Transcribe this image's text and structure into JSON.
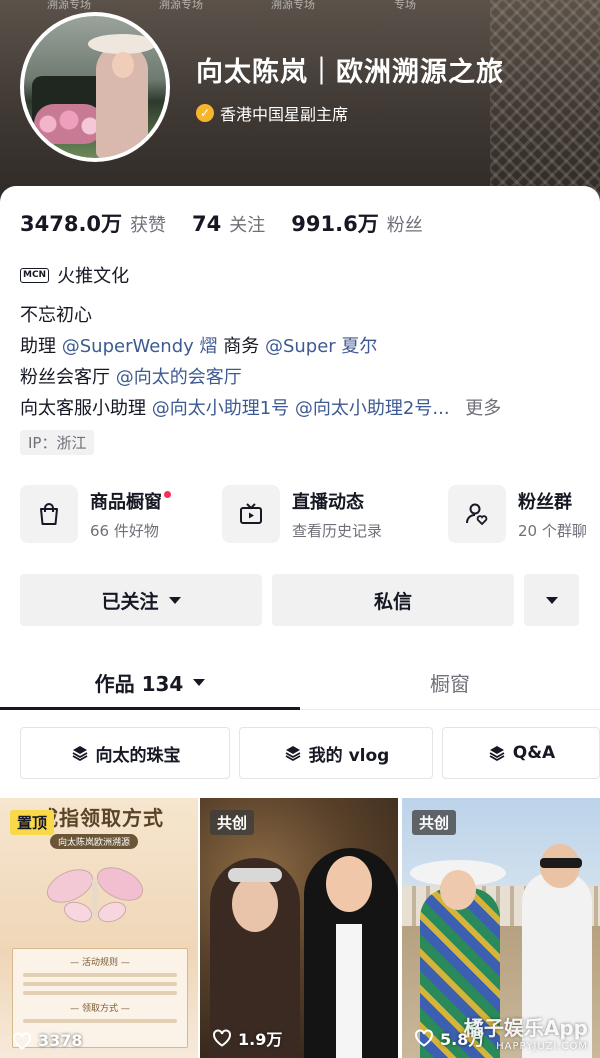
{
  "banner": {
    "tags": [
      "溯源专场",
      "溯源专场",
      "溯源专场",
      "专场"
    ]
  },
  "profile": {
    "display_name": "向太陈岚｜欧洲溯源之旅",
    "verified_title": "香港中国星副主席"
  },
  "stats": {
    "likes_value": "3478.0万",
    "likes_label": "获赞",
    "following_value": "74",
    "following_label": "关注",
    "followers_value": "991.6万",
    "followers_label": "粉丝"
  },
  "mcn": {
    "badge": "MCN",
    "name": "火推文化"
  },
  "bio": {
    "line1": "不忘初心",
    "line2_prefix": "助理",
    "line2_mention1": "@SuperWendy 熠",
    "line2_mid": "商务",
    "line2_mention2": "@Super 夏尔",
    "line3_prefix": "粉丝会客厅",
    "line3_mention": "@向太的会客厅",
    "line4_prefix": "向太客服小助理",
    "line4_mention1": "@向太小助理1号",
    "line4_mention2": "@向太小助理2号...",
    "more": "更多"
  },
  "ip": "IP：浙江",
  "features": [
    {
      "title": "商品橱窗",
      "sub": "66 件好物",
      "icon": "shopping-bag-icon"
    },
    {
      "title": "直播动态",
      "sub": "查看历史记录",
      "icon": "tv-icon"
    },
    {
      "title": "粉丝群",
      "sub": "20 个群聊",
      "icon": "fan-group-icon"
    }
  ],
  "actions": {
    "follow": "已关注",
    "message": "私信"
  },
  "tabs": {
    "works": "作品 134",
    "showcase": "橱窗"
  },
  "collections": [
    "向太的珠宝",
    "我的 vlog",
    "Q&A"
  ],
  "videos": [
    {
      "badge": "置顶",
      "likes": "3378",
      "heading": "戒指领取方式",
      "sub": "向太陈岚欧洲溯源",
      "rules_title": "— 活动规则 —",
      "rules_title2": "— 领取方式 —"
    },
    {
      "badge": "共创",
      "likes": "1.9万"
    },
    {
      "badge": "共创",
      "likes": "5.8万"
    }
  ],
  "watermark": {
    "brand": "橘子娱乐App",
    "url": "HAPPYJUZI.COM"
  },
  "colors": {
    "mention": "#3e5a93",
    "pin_badge": "#f9d84a",
    "red_dot": "#fe2c55",
    "verify": "#f7b52c"
  }
}
